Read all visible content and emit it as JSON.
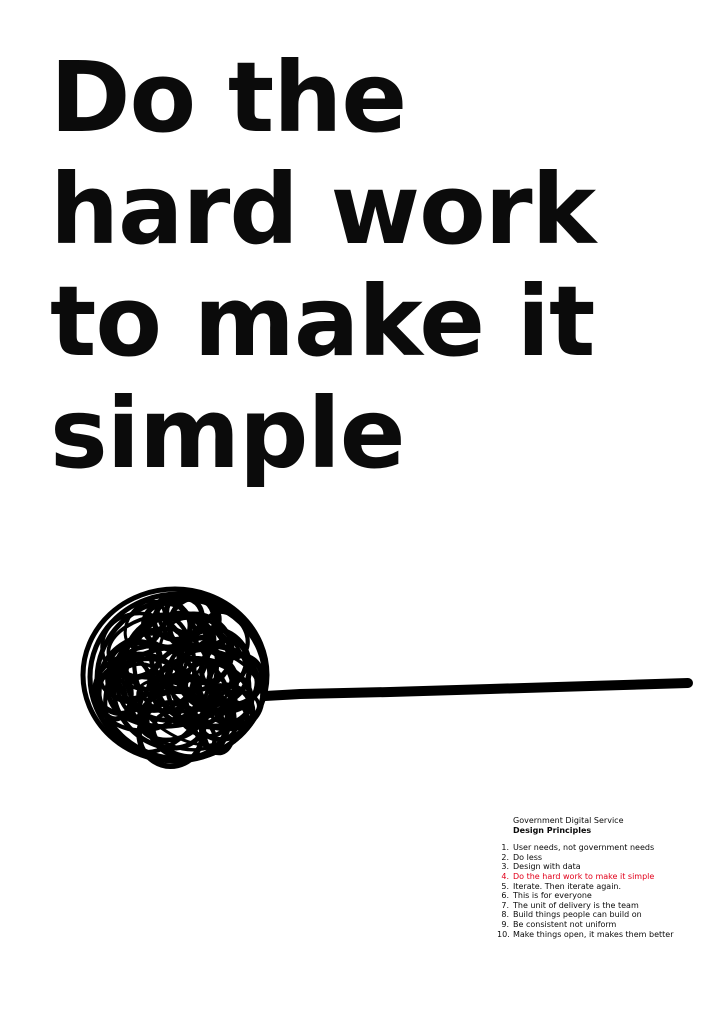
{
  "headline": {
    "lines": [
      "Do the",
      "hard work",
      "to make it",
      "simple"
    ]
  },
  "illustration": {
    "icon": "tangled-ball-of-string-icon",
    "color": "#000000"
  },
  "principles": {
    "organisation": "Government Digital Service",
    "title": "Design Principles",
    "highlight_color": "#e2001a",
    "highlighted_number": "4.",
    "items": [
      {
        "number": "1.",
        "text": "User needs, not government needs"
      },
      {
        "number": "2.",
        "text": "Do less"
      },
      {
        "number": "3.",
        "text": "Design with data"
      },
      {
        "number": "4.",
        "text": "Do the hard work to make it simple"
      },
      {
        "number": "5.",
        "text": "Iterate. Then iterate again."
      },
      {
        "number": "6.",
        "text": "This is for everyone"
      },
      {
        "number": "7.",
        "text": "The unit of delivery is the team"
      },
      {
        "number": "8.",
        "text": "Build things people can build on"
      },
      {
        "number": "9.",
        "text": "Be consistent not uniform"
      },
      {
        "number": "10.",
        "text": "Make things open, it makes them better"
      }
    ]
  }
}
